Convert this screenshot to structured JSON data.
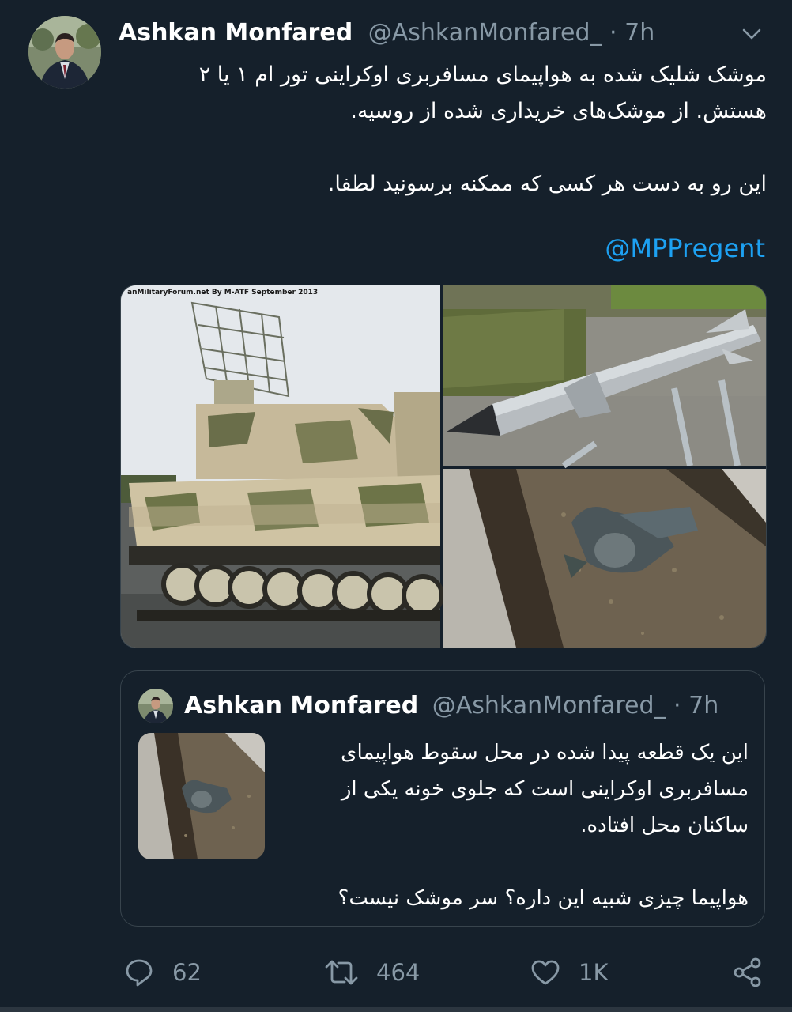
{
  "tweet": {
    "author_name": "Ashkan Monfared",
    "author_handle": "@AshkanMonfared_",
    "separator": "·",
    "time": "7h",
    "text_lines": [
      "موشک شلیک شده به هواپیمای مسافربری اوکراینی تور ام ۱ یا ۲",
      "هستش. از موشک‌های خریداری شده از روسیه."
    ],
    "text_para2": "این رو به دست هر کسی که ممکنه برسونید لطفا.",
    "mention": "@MPPregent",
    "image_watermark": "anMilitaryForum.net   By M-ATF   September 2013"
  },
  "quoted_tweet": {
    "author_name": "Ashkan Monfared",
    "author_handle": "@AshkanMonfared_",
    "separator": "·",
    "time": "7h",
    "text_lines": [
      "این یک قطعه پیدا شده در محل سقوط هواپیمای",
      "مسافربری اوکراینی است که جلوی خونه یکی از",
      "ساکنان محل افتاده."
    ],
    "text_para2": "هواپیما چیزی شبیه این داره؟ سر موشک نیست؟"
  },
  "actions": {
    "reply_count": "62",
    "retweet_count": "464",
    "like_count": "1K"
  },
  "icons": [
    "chevron-down-icon",
    "reply-icon",
    "retweet-icon",
    "like-icon",
    "share-icon"
  ],
  "colors": {
    "background": "#15202b",
    "link": "#1da1f2",
    "secondary_text": "#8899a6",
    "border": "#38444d"
  }
}
